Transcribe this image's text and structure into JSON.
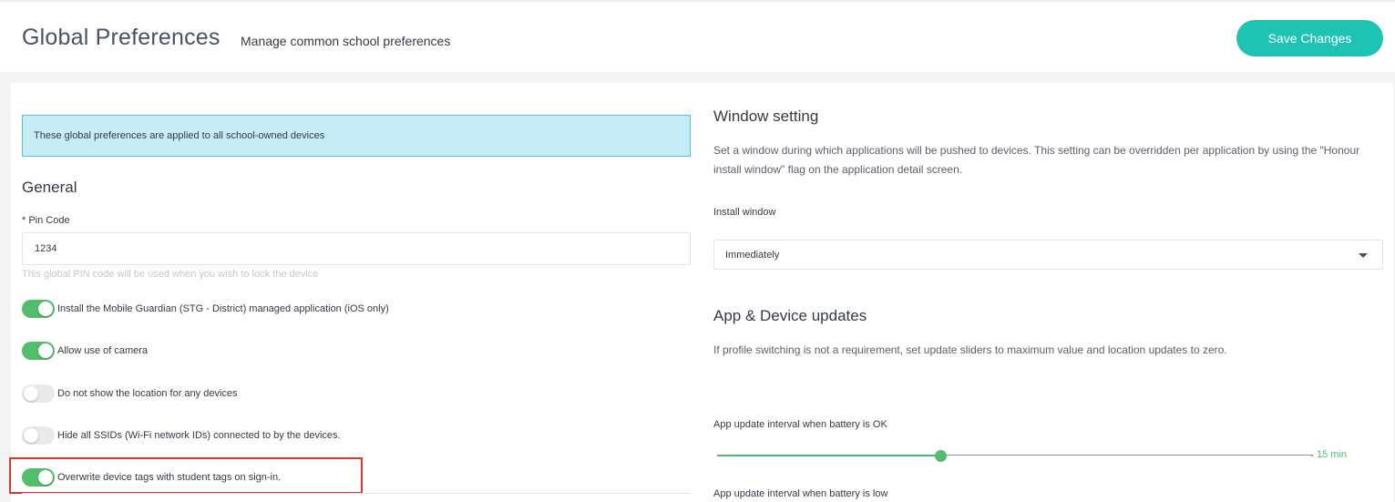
{
  "header": {
    "title": "Global Preferences",
    "subtitle": "Manage common school preferences",
    "save_label": "Save Changes"
  },
  "banner": {
    "text": "These global preferences are applied to all school-owned devices"
  },
  "general": {
    "title": "General",
    "pin_label": "* Pin Code",
    "pin_value": "1234",
    "pin_help": "This global PIN code will be used when you wish to lock the device",
    "toggles": [
      {
        "label": "Install the Mobile Guardian (STG - District) managed application (iOS only)",
        "on": true
      },
      {
        "label": "Allow use of camera",
        "on": true
      },
      {
        "label": "Do not show the location for any devices",
        "on": false
      },
      {
        "label": "Hide all SSIDs (Wi-Fi network IDs) connected to by the devices.",
        "on": false
      },
      {
        "label": "Overwrite device tags with student tags on sign-in.",
        "on": true
      }
    ]
  },
  "window_setting": {
    "title": "Window setting",
    "description": "Set a window during which applications will be pushed to devices. This setting can be overridden per application by using the \"Honour install window\" flag on the application detail screen.",
    "install_label": "Install window",
    "install_value": "Immediately"
  },
  "updates": {
    "title": "App & Device updates",
    "description": "If profile switching is not a requirement, set update sliders to maximum value and location updates to zero.",
    "battery_ok_label": "App update interval when battery is OK",
    "battery_ok_value": "15 min",
    "battery_ok_fraction": 0.375,
    "battery_low_label": "App update interval when battery is low"
  },
  "colors": {
    "accent": "#1fc3b4",
    "toggle_on": "#52be6d",
    "highlight": "#e0352b",
    "banner_bg": "#c6ecf6"
  }
}
